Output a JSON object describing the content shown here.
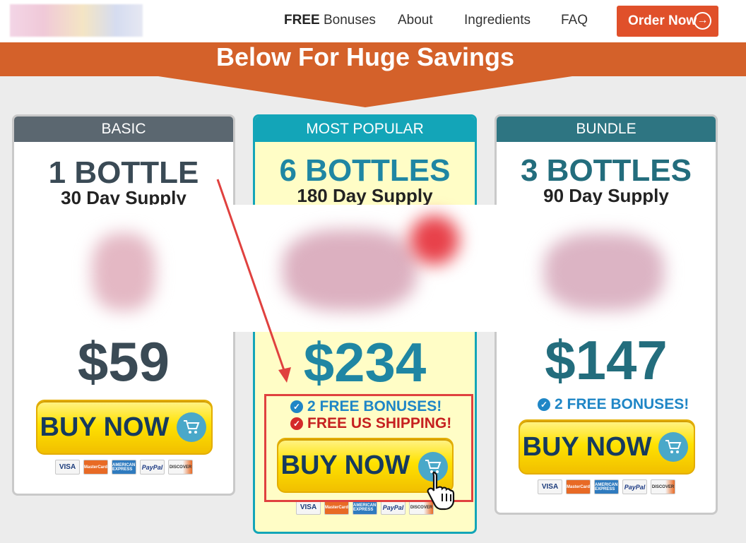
{
  "header": {
    "nav": [
      {
        "bold": "FREE",
        "label": " Bonuses"
      },
      {
        "label": "About"
      },
      {
        "label": "Ingredients"
      },
      {
        "label": "FAQ"
      }
    ],
    "order_button": "Order Now"
  },
  "banner": {
    "title": "Below For Huge Savings"
  },
  "cards": [
    {
      "head": "BASIC",
      "qty": "1 BOTTLE",
      "supply": "30 Day Supply",
      "price": "$59",
      "buy": "BUY NOW",
      "head_color": "#5b6770",
      "qty_color": "#3a4a55",
      "price_color": "#3a4a55"
    },
    {
      "head": "MOST POPULAR",
      "qty": "6 BOTTLES",
      "supply": "180 Day Supply",
      "price": "$234",
      "buy": "BUY NOW",
      "bonus": "2 FREE BONUSES!",
      "shipping": "FREE US SHIPPING!",
      "head_color": "#13a5b8",
      "qty_color": "#1f86a3",
      "price_color": "#1f86a3"
    },
    {
      "head": "BUNDLE",
      "qty": "3 BOTTLES",
      "supply": "90 Day Supply",
      "price": "$147",
      "buy": "BUY NOW",
      "bonus": "2 FREE BONUSES!",
      "head_color": "#2e7582",
      "qty_color": "#236d7d",
      "price_color": "#236d7d"
    }
  ],
  "payments": [
    "VISA",
    "MasterCard",
    "AMERICAN EXPRESS",
    "PayPal",
    "DISCOVER"
  ],
  "colors": {
    "accent": "#e0502a",
    "banner": "#d4612a",
    "check_blue": "#1f86c6",
    "check_red": "#d42a2a",
    "shipping_red": "#c62020",
    "bonus_blue": "#1f86c6"
  },
  "icons": [
    "arrow-right-circle-icon",
    "cart-icon",
    "check-circle-icon",
    "pointer-hand-icon"
  ]
}
